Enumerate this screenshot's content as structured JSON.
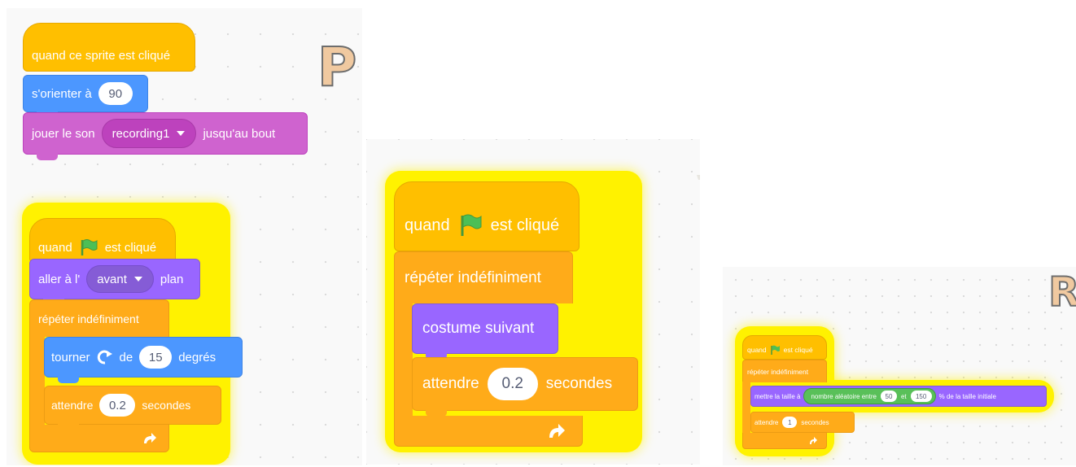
{
  "panel1": {
    "sprite_letter": "P",
    "script1": {
      "hat": "quand ce sprite est cliqué",
      "point_label": "s'orienter à",
      "point_value": "90",
      "sound_label": "jouer le son",
      "sound_value": "recording1",
      "sound_suffix": "jusqu'au bout"
    },
    "script2": {
      "hat_quand": "quand",
      "hat_clicked": "est cliqué",
      "layer_label": "aller à l'",
      "layer_value": "avant",
      "layer_suffix": "plan",
      "forever": "répéter indéfiniment",
      "turn_label": "tourner",
      "turn_de": "de",
      "turn_value": "15",
      "turn_suffix": "degrés",
      "wait_label": "attendre",
      "wait_value": "0.2",
      "wait_suffix": "secondes"
    }
  },
  "panel2": {
    "hat_quand": "quand",
    "hat_clicked": "est cliqué",
    "forever": "répéter indéfiniment",
    "costume": "costume suivant",
    "wait_label": "attendre",
    "wait_value": "0.2",
    "wait_suffix": "secondes"
  },
  "panel3": {
    "sprite_letter": "R",
    "hat_quand": "quand",
    "hat_clicked": "est cliqué",
    "forever": "répéter indéfiniment",
    "size_label": "mettre la taille à",
    "random_label": "nombre aléatoire entre",
    "random_min": "50",
    "random_et": "et",
    "random_max": "150",
    "size_suffix": "% de la taille initiale",
    "wait_label": "attendre",
    "wait_value": "1",
    "wait_suffix": "secondes"
  },
  "colors": {
    "events": "#ffbf00",
    "control": "#ffab19",
    "motion": "#4c97ff",
    "looks": "#9966ff",
    "sound": "#cf63cf",
    "operators": "#59c059",
    "glow": "#fff200",
    "flag": "#4cbf56"
  },
  "icons": [
    "green-flag-icon",
    "turn-right-icon",
    "loop-arrow-icon",
    "dropdown-arrow-icon"
  ]
}
